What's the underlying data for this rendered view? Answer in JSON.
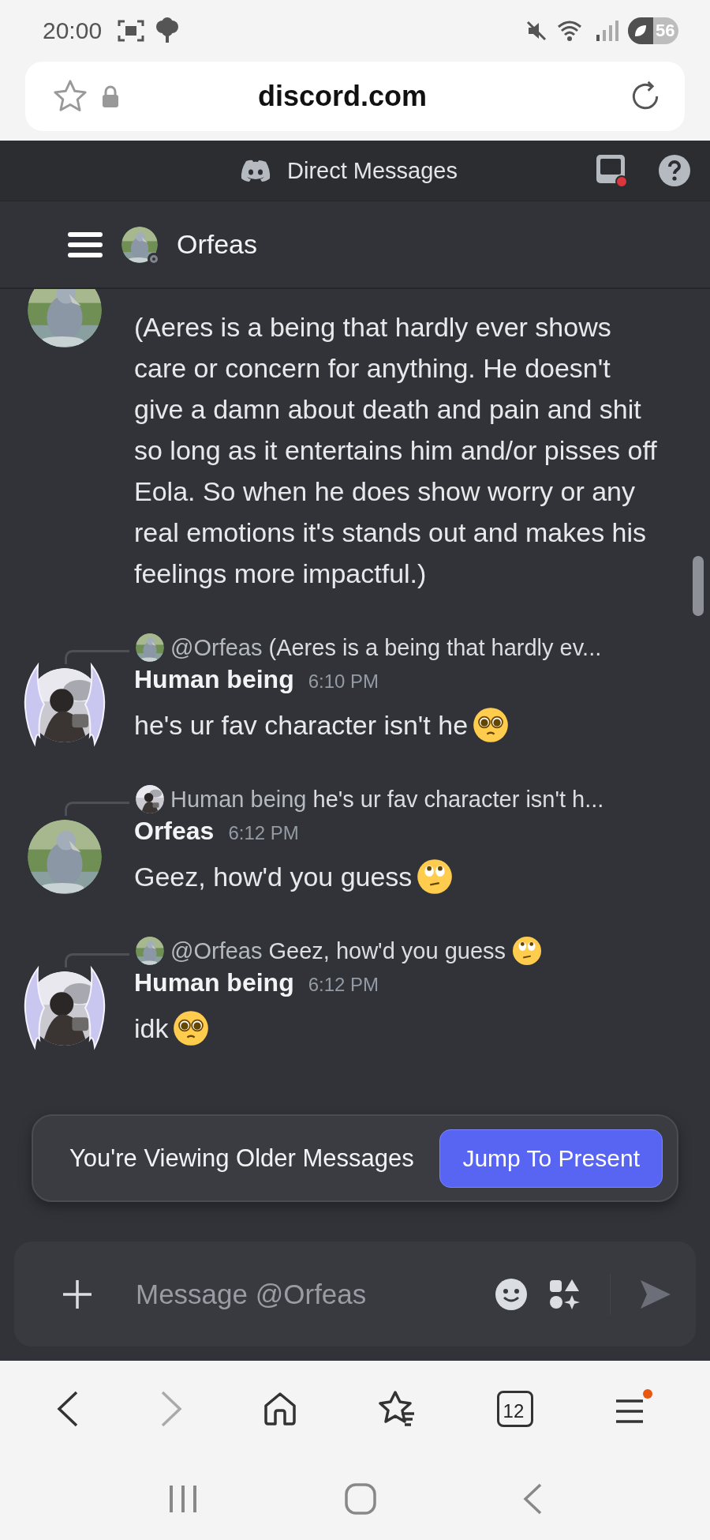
{
  "status_bar": {
    "time": "20:00",
    "battery": "56"
  },
  "address_bar": {
    "url": "discord.com"
  },
  "app_header": {
    "title": "Direct Messages",
    "inbox_unread": true
  },
  "channel_header": {
    "name": "Orfeas"
  },
  "messages": [
    {
      "avatar": {
        "decorated": false
      },
      "text": "(Aeres is a being that hardly ever shows care or concern for anything. He doesn't give a damn about death and pain and shit so long as it entertains him and/or pisses off Eola. So when he does show worry or any real emotions it's stands out and makes his feelings more impactful.)"
    },
    {
      "reply": {
        "avatar_decorated": false,
        "author": "@Orfeas",
        "text": "(Aeres is a being that hardly ev..."
      },
      "avatar": {
        "decorated": true
      },
      "author": "Human being",
      "time": "6:10 PM",
      "text": "he's ur fav character isn't he",
      "emoji": {
        "kind": "pleading"
      }
    },
    {
      "reply": {
        "avatar_decorated": true,
        "author": "Human being",
        "text": "he's ur fav character isn't h..."
      },
      "avatar": {
        "decorated": false
      },
      "author": "Orfeas",
      "time": "6:12 PM",
      "text": "Geez, how'd you guess",
      "emoji": {
        "kind": "eyeroll"
      }
    },
    {
      "reply": {
        "avatar_decorated": false,
        "author": "@Orfeas",
        "text": "Geez, how'd you guess",
        "emoji": {
          "kind": "eyeroll"
        }
      },
      "avatar": {
        "decorated": true
      },
      "author": "Human being",
      "time": "6:12 PM",
      "text": "idk",
      "emoji": {
        "kind": "pleading"
      }
    }
  ],
  "older_messages_banner": {
    "text": "You're Viewing Older Messages",
    "button": "Jump To Present"
  },
  "composer": {
    "placeholder": "Message @Orfeas"
  },
  "browser_toolbar": {
    "back_disabled": false,
    "forward_disabled": true,
    "tab_count": "12",
    "menu_badge": true
  }
}
